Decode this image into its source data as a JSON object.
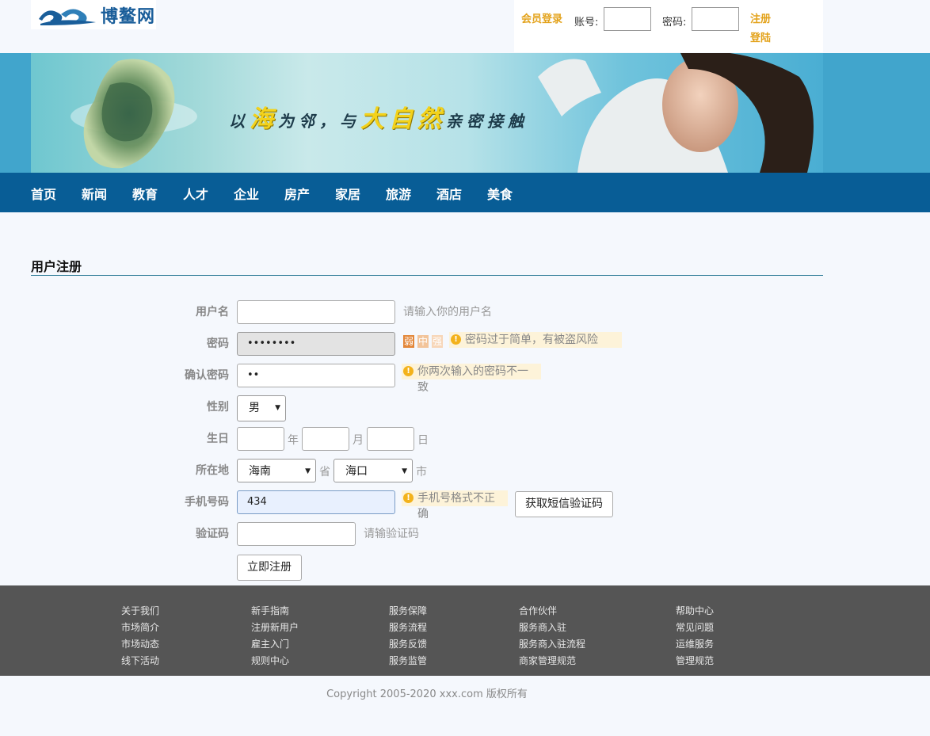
{
  "header": {
    "logo_text": "博鳌网",
    "login_title": "会员登录",
    "account_label": "账号:",
    "password_label": "密码:",
    "register_link": "注册",
    "login_link": "登陆"
  },
  "banner": {
    "slogan_part1": "以",
    "slogan_hl1": "海",
    "slogan_part2": "为邻，与",
    "slogan_hl2": "大自然",
    "slogan_part3": "亲密接触"
  },
  "nav": {
    "items": [
      "首页",
      "新闻",
      "教育",
      "人才",
      "企业",
      "房产",
      "家居",
      "旅游",
      "酒店",
      "美食"
    ]
  },
  "page": {
    "title": "用户注册"
  },
  "form": {
    "username": {
      "label": "用户名",
      "value": "",
      "hint": "请输入你的用户名"
    },
    "password": {
      "label": "密码",
      "value": "••••••••",
      "strength_weak": "弱",
      "strength_mid": "中",
      "strength_strong": "强",
      "warning": "密码过于简单，有被盗风险"
    },
    "confirm": {
      "label": "确认密码",
      "value": "••",
      "warning": "你两次输入的密码不一致"
    },
    "gender": {
      "label": "性别",
      "selected": "男"
    },
    "birthday": {
      "label": "生日",
      "year_unit": "年",
      "month_unit": "月",
      "day_unit": "日"
    },
    "location": {
      "label": "所在地",
      "province": "海南",
      "province_unit": "省",
      "city": "海口",
      "city_unit": "市"
    },
    "phone": {
      "label": "手机号码",
      "value": "434",
      "warning": "手机号格式不正确",
      "sms_button": "获取短信验证码"
    },
    "captcha": {
      "label": "验证码",
      "value": "",
      "hint": "请输验证码"
    },
    "submit": "立即注册"
  },
  "footer": {
    "columns": [
      [
        "关于我们",
        "市场简介",
        "市场动态",
        "线下活动"
      ],
      [
        "新手指南",
        "注册新用户",
        "雇主入门",
        "规则中心"
      ],
      [
        "服务保障",
        "服务流程",
        "服务反馈",
        "服务监管"
      ],
      [
        "合作伙伴",
        "服务商入驻",
        "服务商入驻流程",
        "商家管理规范"
      ],
      [
        "帮助中心",
        "常见问题",
        "运维服务",
        "管理规范"
      ]
    ],
    "copyright": "Copyright 2005-2020 xxx.com 版权所有"
  },
  "colors": {
    "nav_bg": "#085d96",
    "accent": "#e3a21a",
    "footer_bg": "#555555"
  }
}
